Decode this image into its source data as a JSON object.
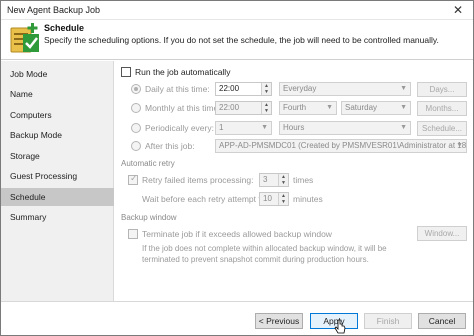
{
  "window": {
    "title": "New Agent Backup Job",
    "close_glyph": "✕"
  },
  "header": {
    "title": "Schedule",
    "subtitle": "Specify the scheduling options. If you do not set the schedule, the job will need to be controlled manually.",
    "icon": "schedule-wizard-icon"
  },
  "sidebar": {
    "items": [
      {
        "label": "Job Mode"
      },
      {
        "label": "Name"
      },
      {
        "label": "Computers"
      },
      {
        "label": "Backup Mode"
      },
      {
        "label": "Storage"
      },
      {
        "label": "Guest Processing"
      },
      {
        "label": "Schedule",
        "active": true
      },
      {
        "label": "Summary"
      }
    ]
  },
  "schedule": {
    "run_auto_label": "Run the job automatically",
    "daily": {
      "label": "Daily at this time:",
      "time": "22:00",
      "mode": "Everyday",
      "button": "Days..."
    },
    "monthly": {
      "label": "Monthly at this time:",
      "time": "22:00",
      "week": "Fourth",
      "day": "Saturday",
      "button": "Months..."
    },
    "periodically": {
      "label": "Periodically every:",
      "value": "1",
      "unit": "Hours",
      "button": "Schedule..."
    },
    "after_job": {
      "label": "After this job:",
      "value": "APP-AD-PMSMDC01 (Created by PMSMVESR01\\Administrator at 18/0"
    }
  },
  "retry": {
    "section_label": "Automatic retry",
    "retry_label": "Retry failed items processing:",
    "retry_value": "3",
    "retry_unit": "times",
    "wait_label": "Wait before each retry attempt for:",
    "wait_value": "10",
    "wait_unit": "minutes"
  },
  "window_section": {
    "section_label": "Backup window",
    "terminate_label": "Terminate job if it exceeds allowed backup window",
    "button": "Window...",
    "note_line1": "If the job does not complete within allocated backup window, it will be",
    "note_line2": "terminated to prevent snapshot commit during production hours."
  },
  "footer": {
    "previous": "< Previous",
    "apply": "Apply",
    "finish": "Finish",
    "cancel": "Cancel"
  },
  "colors": {
    "active_sidebar": "#c7c7c7",
    "primary_border": "#0078d7",
    "logo_green": "#2e9a3a",
    "logo_yellow": "#e8c04a"
  }
}
